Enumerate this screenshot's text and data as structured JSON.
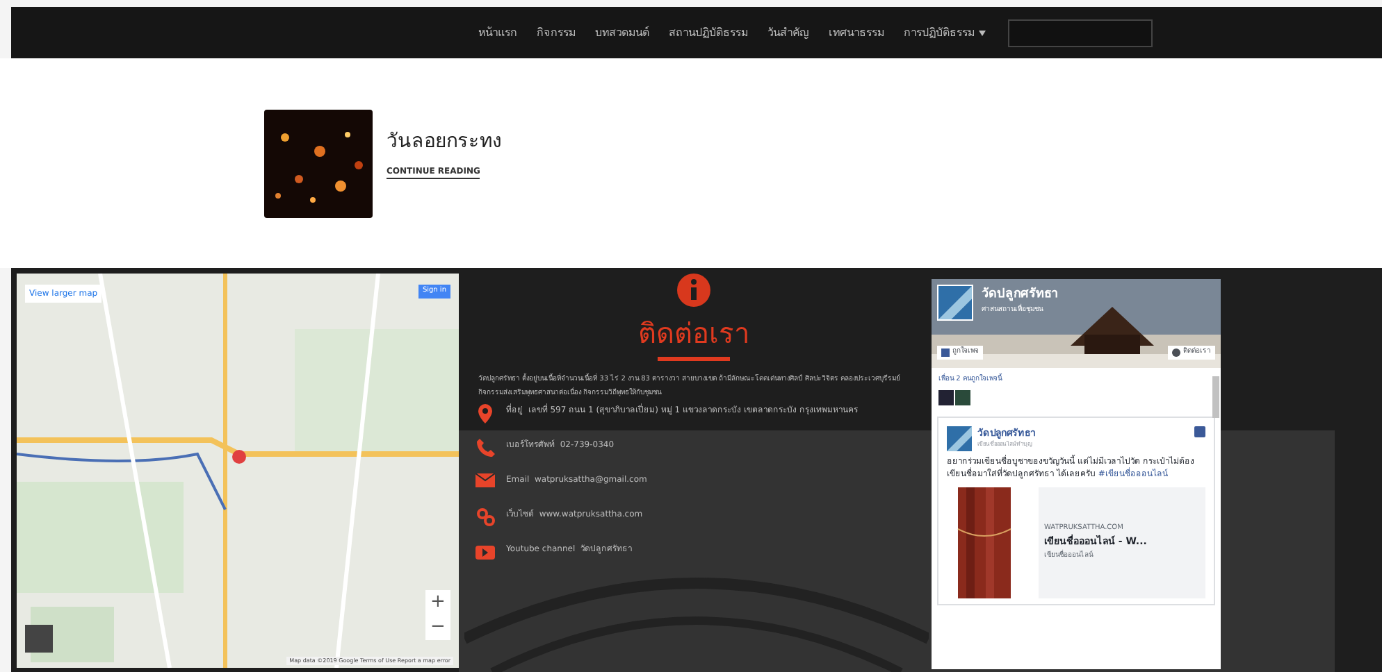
{
  "nav": {
    "items": [
      {
        "label": "หน้าแรก",
        "dropdown": false
      },
      {
        "label": "กิจกรรม",
        "dropdown": false
      },
      {
        "label": "บทสวดมนต์",
        "dropdown": false
      },
      {
        "label": "สถานปฏิบัติธรรม",
        "dropdown": false
      },
      {
        "label": "วันสำคัญ",
        "dropdown": false
      },
      {
        "label": "เทศนาธรรม",
        "dropdown": false
      },
      {
        "label": "การปฏิบัติธรรม",
        "dropdown": true
      }
    ]
  },
  "post": {
    "title": "วันลอยกระทง",
    "link": "CONTINUE READING"
  },
  "map": {
    "view_larger": "View larger map",
    "sign_in": "Sign in",
    "zoom_in": "+",
    "zoom_out": "−",
    "footer": "Map data ©2019 Google   Terms of Use   Report a map error"
  },
  "contact": {
    "title": "ติดต่อเรา",
    "intro": "วัดปลูกศรัทธา ตั้งอยู่บนเนื้อที่จำนวนเนื้อที่ 33 ไร่ 2 งาน 83 ตารางวา สายบางเขต ถ้ามีลักษณะโดดเด่นทางศิลป์ ศิลปะวิจิตร คลองประเวศบุรีรมย์ กิจกรรมส่งเสริมพุทธศาสนาต่อเนื่อง กิจกรรมวิถีพุทธให้กับชุมชน",
    "rows": [
      {
        "kind": "address",
        "label": "ที่อยู่",
        "value": "เลขที่ 597 ถนน 1 (สุขาภิบาลเปี่ยม) หมู่ 1 แขวงลาดกระบัง เขตลาดกระบัง กรุงเทพมหานคร"
      },
      {
        "kind": "phone",
        "label": "เบอร์โทรศัพท์",
        "value": "02-739-0340"
      },
      {
        "kind": "email",
        "label": "Email",
        "value": "watpruksattha@gmail.com"
      },
      {
        "kind": "website",
        "label": "เว็บไซต์",
        "value": "www.watpruksattha.com"
      },
      {
        "kind": "youtube",
        "label": "Youtube channel",
        "value": "วัดปลูกศรัทธา"
      }
    ]
  },
  "facebook": {
    "page_name": "วัดปลูกศรัทธา",
    "page_sub": "ศาสนสถานเพื่อชุมชน",
    "like_button": "ถูกใจเพจ",
    "contact_button": "ติดต่อเรา",
    "friends": "เพื่อน 2 คนถูกใจเพจนี้",
    "post": {
      "author": "วัดปลูกศรัทธา",
      "sub": "เขียนชื่อออนไลน์ทำบุญ",
      "text": "อยากร่วมเขียนชื่อบูชาของขวัญวันนี้ แต่ไม่มีเวลาไปวัด กระเป๋าไม่ต้องเขียนชื่อมาใส่ที่วัดปลูกศรัทธา ได้เลยครับ",
      "hashtag": "#เขียนชื่อออนไลน์",
      "card_domain": "WATPRUKSATTHA.COM",
      "card_title": "เขียนชื่อออนไลน์ - W...",
      "card_desc": "เขียนชื่อออนไลน์"
    }
  }
}
